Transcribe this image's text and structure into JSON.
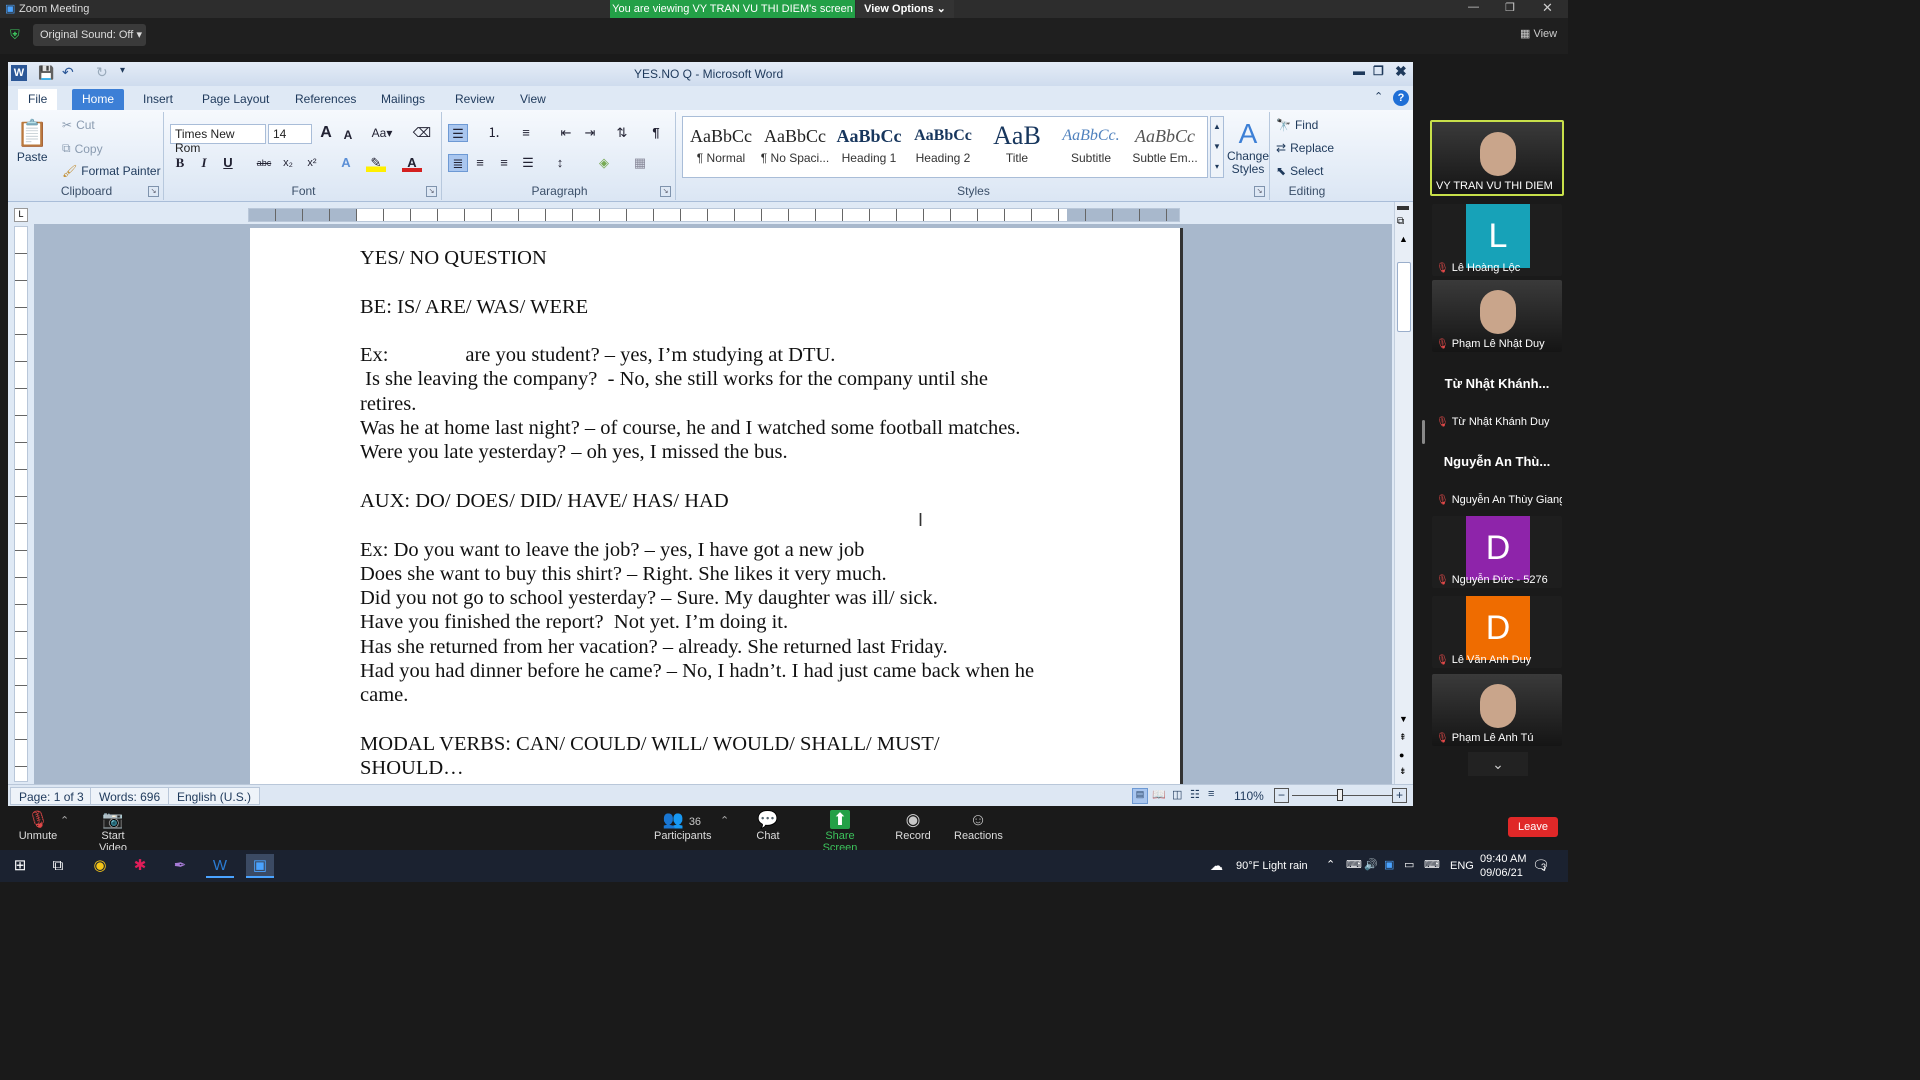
{
  "zoom": {
    "window_title": "Zoom Meeting",
    "banner_text": "You are viewing VY TRAN VU THI DIEM's screen",
    "view_options_label": "View Options",
    "original_sound_label": "Original Sound: Off",
    "view_label": "View",
    "controls": {
      "unmute": "Unmute",
      "start_video": "Start Video",
      "participants": "Participants",
      "participants_count": "36",
      "chat": "Chat",
      "share_screen": "Share Screen",
      "record": "Record",
      "reactions": "Reactions",
      "leave": "Leave"
    },
    "participants": [
      {
        "name": "VY TRAN VU THI DIEM",
        "type": "video",
        "highlight": true
      },
      {
        "name": "Lê Hoàng Lộc",
        "type": "avatar",
        "letter": "L",
        "color": "#17a2b8"
      },
      {
        "name": "Phạm Lê Nhật Duy",
        "type": "video"
      },
      {
        "name": "Từ Nhật Khánh Duy",
        "type": "text",
        "display": "Từ Nhật Khánh..."
      },
      {
        "name": "Nguyễn An Thùy Giang",
        "type": "text",
        "display": "Nguyễn An Thù..."
      },
      {
        "name": "Nguyễn Đức - 5276",
        "type": "avatar",
        "letter": "D",
        "color": "#8e24aa"
      },
      {
        "name": "Lê Văn Anh Duy",
        "type": "avatar",
        "letter": "D",
        "color": "#ef6c00"
      },
      {
        "name": "Phạm Lê Anh Tú",
        "type": "video"
      }
    ]
  },
  "word": {
    "title": "YES.NO Q - Microsoft Word",
    "tabs": [
      "File",
      "Home",
      "Insert",
      "Page Layout",
      "References",
      "Mailings",
      "Review",
      "View"
    ],
    "active_tab": "Home",
    "clipboard": {
      "paste": "Paste",
      "cut": "Cut",
      "copy": "Copy",
      "format_painter": "Format Painter",
      "label": "Clipboard"
    },
    "font": {
      "name": "Times New Rom",
      "size": "14",
      "label": "Font"
    },
    "paragraph_label": "Paragraph",
    "styles": {
      "label": "Styles",
      "items": [
        {
          "preview": "AaBbCc",
          "name": "¶ Normal"
        },
        {
          "preview": "AaBbCc",
          "name": "¶ No Spaci..."
        },
        {
          "preview": "AaBbCc",
          "name": "Heading 1"
        },
        {
          "preview": "AaBbCc",
          "name": "Heading 2"
        },
        {
          "preview": "AaB",
          "name": "Title"
        },
        {
          "preview": "AaBbCc.",
          "name": "Subtitle"
        },
        {
          "preview": "AaBbCc",
          "name": "Subtle Em..."
        }
      ],
      "change_styles": "Change Styles"
    },
    "editing": {
      "find": "Find",
      "replace": "Replace",
      "select": "Select",
      "label": "Editing"
    },
    "document_lines": [
      "YES/ NO QUESTION",
      "",
      "BE: IS/ ARE/ WAS/ WERE",
      "",
      "Ex:               are you student? – yes, I’m studying at DTU.",
      " Is she leaving the company?  - No, she still works for the company until she",
      "retires.",
      "Was he at home last night? – of course, he and I watched some football matches.",
      "Were you late yesterday? – oh yes, I missed the bus.",
      "",
      "AUX: DO/ DOES/ DID/ HAVE/ HAS/ HAD",
      "",
      "Ex: Do you want to leave the job? – yes, I have got a new job",
      "Does she want to buy this shirt? – Right. She likes it very much.",
      "Did you not go to school yesterday? – Sure. My daughter was ill/ sick.",
      "Have you finished the report?  Not yet. I’m doing it.",
      "Has she returned from her vacation? – already. She returned last Friday.",
      "Had you had dinner before he came? – No, I hadn’t. I had just came back when he",
      "came.",
      "",
      "MODAL VERBS: CAN/ COULD/ WILL/ WOULD/ SHALL/ MUST/",
      "SHOULD…"
    ],
    "status": {
      "page": "Page: 1 of 3",
      "words": "Words: 696",
      "language": "English (U.S.)",
      "zoom": "110%"
    }
  },
  "taskbar": {
    "weather": "90°F  Light rain",
    "lang": "ENG",
    "time": "09:40 AM",
    "date": "09/06/21",
    "notifications": "3"
  }
}
